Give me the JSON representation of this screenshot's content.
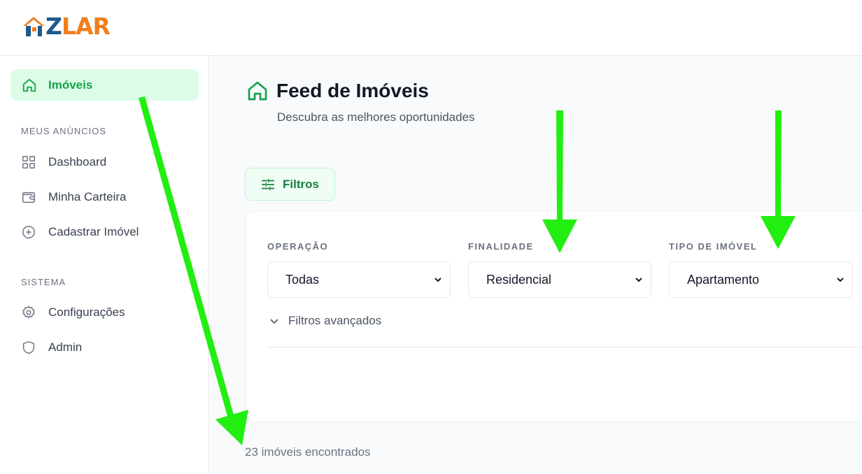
{
  "brand": {
    "logo_text_z": "Z",
    "logo_text_rest": "LAR",
    "colors": {
      "blue": "#1e5a8c",
      "orange": "#f07f1c"
    }
  },
  "sidebar": {
    "active_item": {
      "label": "Imóveis",
      "icon": "home-icon"
    },
    "section_ads": "MEUS ANÚNCIOS",
    "ads_items": [
      {
        "label": "Dashboard",
        "icon": "grid-icon"
      },
      {
        "label": "Minha Carteira",
        "icon": "wallet-icon"
      },
      {
        "label": "Cadastrar Imóvel",
        "icon": "plus-circle-icon"
      }
    ],
    "section_system": "SISTEMA",
    "system_items": [
      {
        "label": "Configurações",
        "icon": "gear-icon"
      },
      {
        "label": "Admin",
        "icon": "shield-icon"
      }
    ]
  },
  "main": {
    "title": "Feed de Imóveis",
    "subtitle": "Descubra as melhores oportunidades",
    "filters_button": "Filtros",
    "filters": [
      {
        "label": "OPERAÇÃO",
        "value": "Todas"
      },
      {
        "label": "FINALIDADE",
        "value": "Residencial"
      },
      {
        "label": "TIPO DE IMÓVEL",
        "value": "Apartamento"
      }
    ],
    "advanced_filters": "Filtros avançados",
    "results_count": "23 imóveis encontrados"
  },
  "accent": "#16a34a",
  "annotation_color": "#22ee11"
}
